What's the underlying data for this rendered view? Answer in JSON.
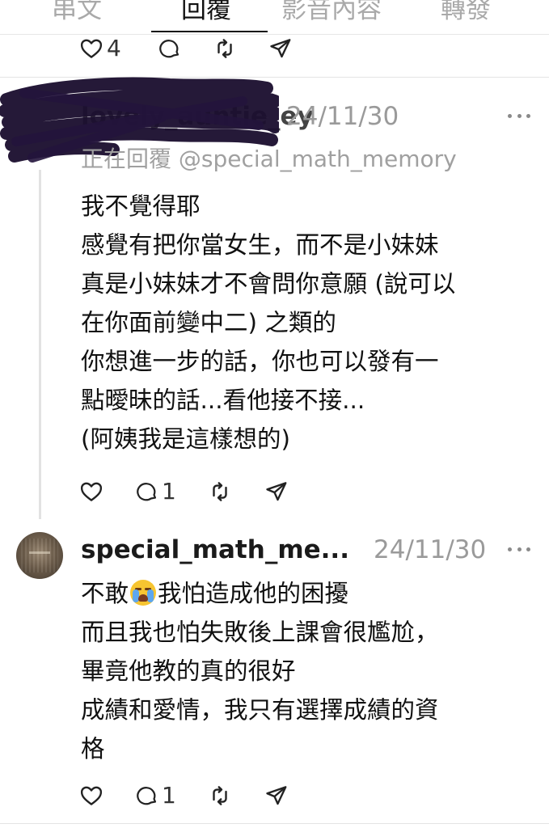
{
  "tabs": [
    {
      "label": "串文"
    },
    {
      "label": "回覆"
    },
    {
      "label": "影音內容"
    },
    {
      "label": "轉發"
    }
  ],
  "top_actions": {
    "like_count": "4"
  },
  "reply1": {
    "author_redacted": "lovely_auntie_ey",
    "date": "24/11/30",
    "replying_to": "正在回覆 @special_math_memory",
    "lines": [
      "我不覺得耶",
      "感覺有把你當女生，而不是小妹妹",
      "真是小妹妹才不會問你意願 (說可以",
      "在你面前變中二) 之類的",
      "你想進一步的話，你也可以發有一",
      "點曖昧的話...看他接不接...",
      "(阿姨我是這樣想的)"
    ],
    "comment_count": "1"
  },
  "reply2": {
    "author": "special_math_me...",
    "date": "24/11/30",
    "line1_before": "不敢",
    "emoji": "loudly-crying-face",
    "line1_after": "我怕造成他的困擾",
    "lines": [
      "而且我也怕失敗後上課會很尷尬，",
      "畢竟他教的真的很好",
      "成績和愛情，我只有選擇成績的資",
      "格"
    ],
    "comment_count": "1"
  },
  "colors": {
    "text": "#111111",
    "muted": "#9a9a9a",
    "divider": "#e4e4e4",
    "redaction": "#1c1030"
  }
}
